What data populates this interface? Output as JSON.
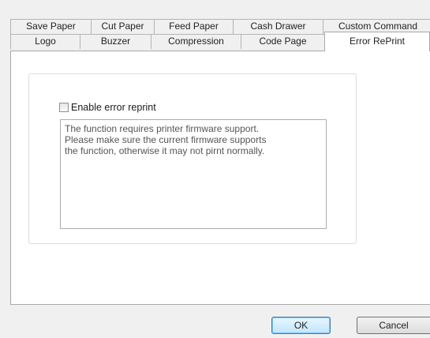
{
  "tabs": {
    "row1": [
      "Save Paper",
      "Cut Paper",
      "Feed Paper",
      "Cash Drawer",
      "Custom Command"
    ],
    "row2": [
      "Logo",
      "Buzzer",
      "Compression",
      "Code Page",
      "Error RePrint"
    ],
    "active": "Error RePrint"
  },
  "error_reprint": {
    "checkbox_label": "Enable error reprint",
    "checkbox_checked": false,
    "notice_lines": [
      "The function requires printer firmware support.",
      "Please make sure the current firmware supports",
      "the function, otherwise it may not pirnt normally."
    ]
  },
  "buttons": {
    "ok_label": "OK",
    "cancel_label": "Cancel"
  }
}
